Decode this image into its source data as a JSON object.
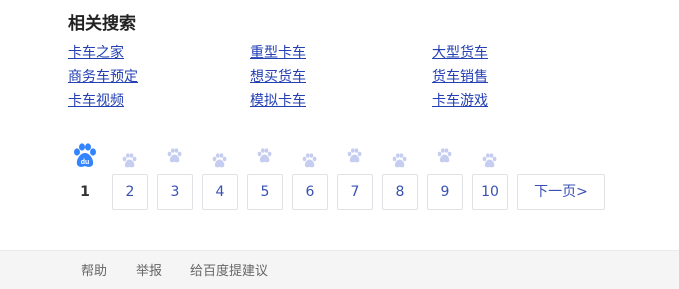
{
  "related": {
    "title": "相关搜索",
    "rows": [
      [
        "卡车之家",
        "重型卡车",
        "大型货车"
      ],
      [
        "商务车预定",
        "想买货车",
        "货车销售"
      ],
      [
        "卡车视频",
        "模拟卡车",
        "卡车游戏"
      ]
    ]
  },
  "pagination": {
    "current": "1",
    "pages": [
      "2",
      "3",
      "4",
      "5",
      "6",
      "7",
      "8",
      "9",
      "10"
    ],
    "next_label": "下一页>",
    "logo_icon": "baidu-paw-logo-icon",
    "paw_icon": "paw-icon",
    "logo_color": "#3385ff",
    "paw_color": "#c5cdf0"
  },
  "footer": {
    "help": "帮助",
    "report": "举报",
    "feedback": "给百度提建议"
  },
  "colors": {
    "link": "#2440b3",
    "page_link": "#3951b3",
    "footer_bg": "#f5f5f6"
  }
}
